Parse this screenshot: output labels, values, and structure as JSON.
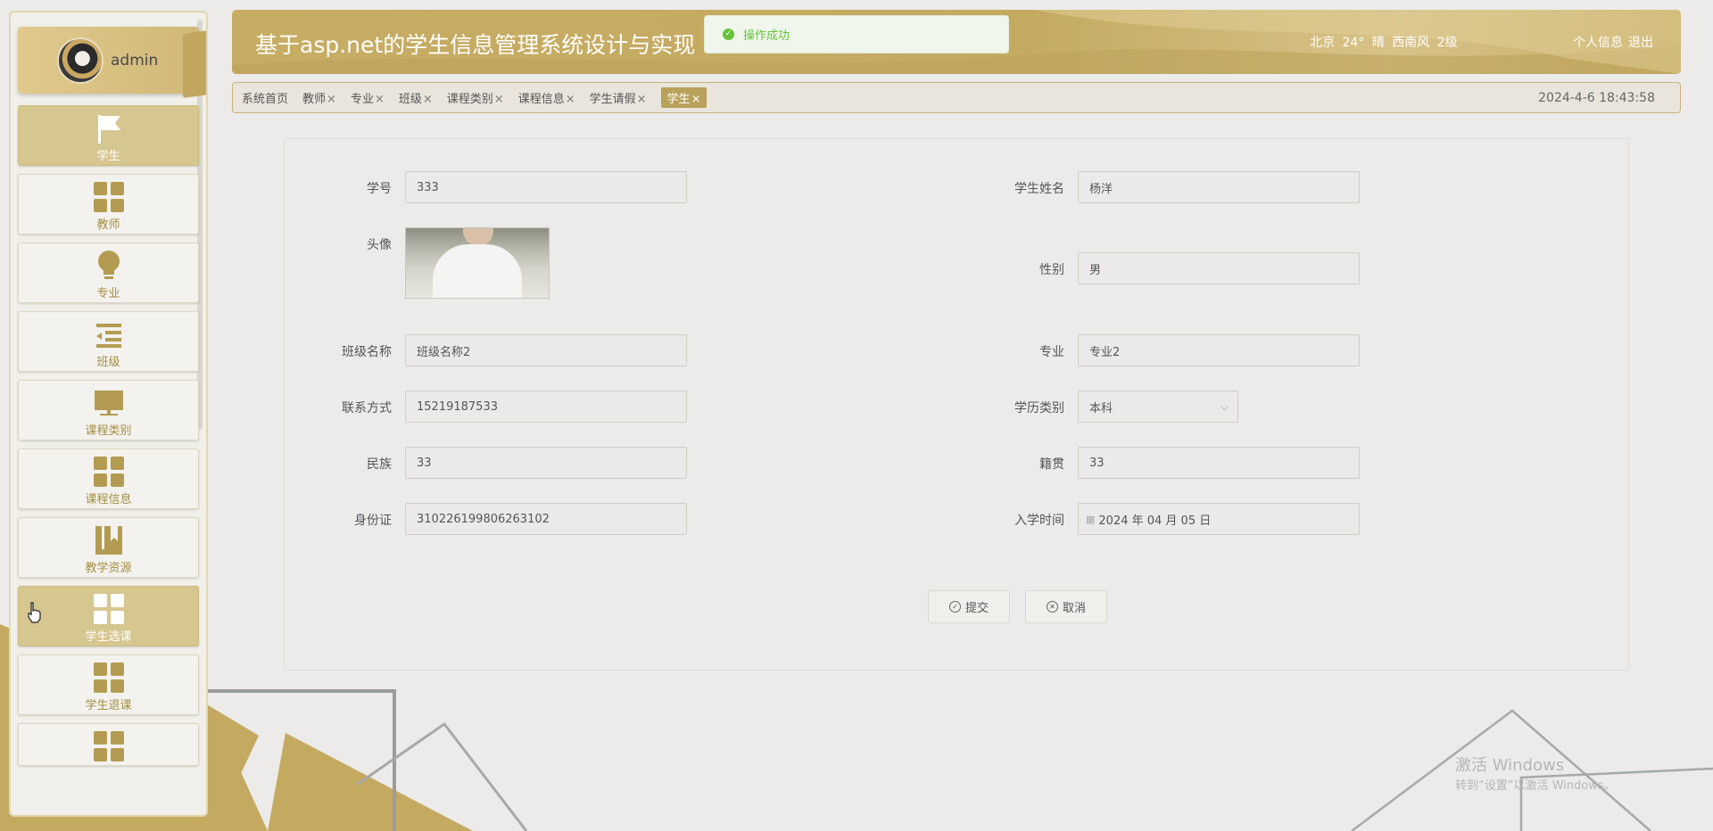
{
  "app": {
    "title": "基于asp.net的学生信息管理系统设计与实现",
    "weather": "北京 24° 晴 西南风 2级",
    "user_links": [
      "个人信息",
      "退出"
    ],
    "datetime": "2024-4-6 18:43:58"
  },
  "toast": {
    "message": "操作成功",
    "color": "#67c23a"
  },
  "sidebar": {
    "username": "admin",
    "items": [
      {
        "label": "学生",
        "icon": "flag-icon"
      },
      {
        "label": "教师",
        "icon": "grid-icon"
      },
      {
        "label": "专业",
        "icon": "lightbulb-icon"
      },
      {
        "label": "班级",
        "icon": "list-indent-icon"
      },
      {
        "label": "课程类别",
        "icon": "monitor-icon"
      },
      {
        "label": "课程信息",
        "icon": "grid-icon"
      },
      {
        "label": "教学资源",
        "icon": "book-icon"
      },
      {
        "label": "学生选课",
        "icon": "grid-icon"
      },
      {
        "label": "学生退课",
        "icon": "grid-icon"
      },
      {
        "label": "",
        "icon": "grid-icon"
      }
    ]
  },
  "tabs": [
    {
      "label": "系统首页"
    },
    {
      "label": "教师"
    },
    {
      "label": "专业"
    },
    {
      "label": "班级"
    },
    {
      "label": "课程类别"
    },
    {
      "label": "课程信息"
    },
    {
      "label": "学生请假"
    },
    {
      "label": "学生"
    }
  ],
  "tab_close_glyph": "×",
  "form": {
    "student_id": {
      "label": "学号",
      "value": "333"
    },
    "student_name": {
      "label": "学生姓名",
      "value": "杨洋"
    },
    "avatar": {
      "label": "头像"
    },
    "gender": {
      "label": "性别",
      "value": "男"
    },
    "class_name": {
      "label": "班级名称",
      "value": "班级名称2"
    },
    "major": {
      "label": "专业",
      "value": "专业2"
    },
    "phone": {
      "label": "联系方式",
      "value": "15219187533"
    },
    "education": {
      "label": "学历类别",
      "value": "本科"
    },
    "ethnicity": {
      "label": "民族",
      "value": "33"
    },
    "native_place": {
      "label": "籍贯",
      "value": "33"
    },
    "id_card": {
      "label": "身份证",
      "value": "310226199806263102"
    },
    "enroll_date": {
      "label": "入学时间",
      "value": "2024 年 04 月 05 日"
    },
    "submit_label": "提交",
    "cancel_label": "取消"
  },
  "watermark": {
    "line1": "激活 Windows",
    "line2": "转到“设置”以激活 Windows。"
  },
  "colors": {
    "accent": "#c4aa61",
    "accent_dark": "#b39c52",
    "panel": "#ebebea"
  }
}
